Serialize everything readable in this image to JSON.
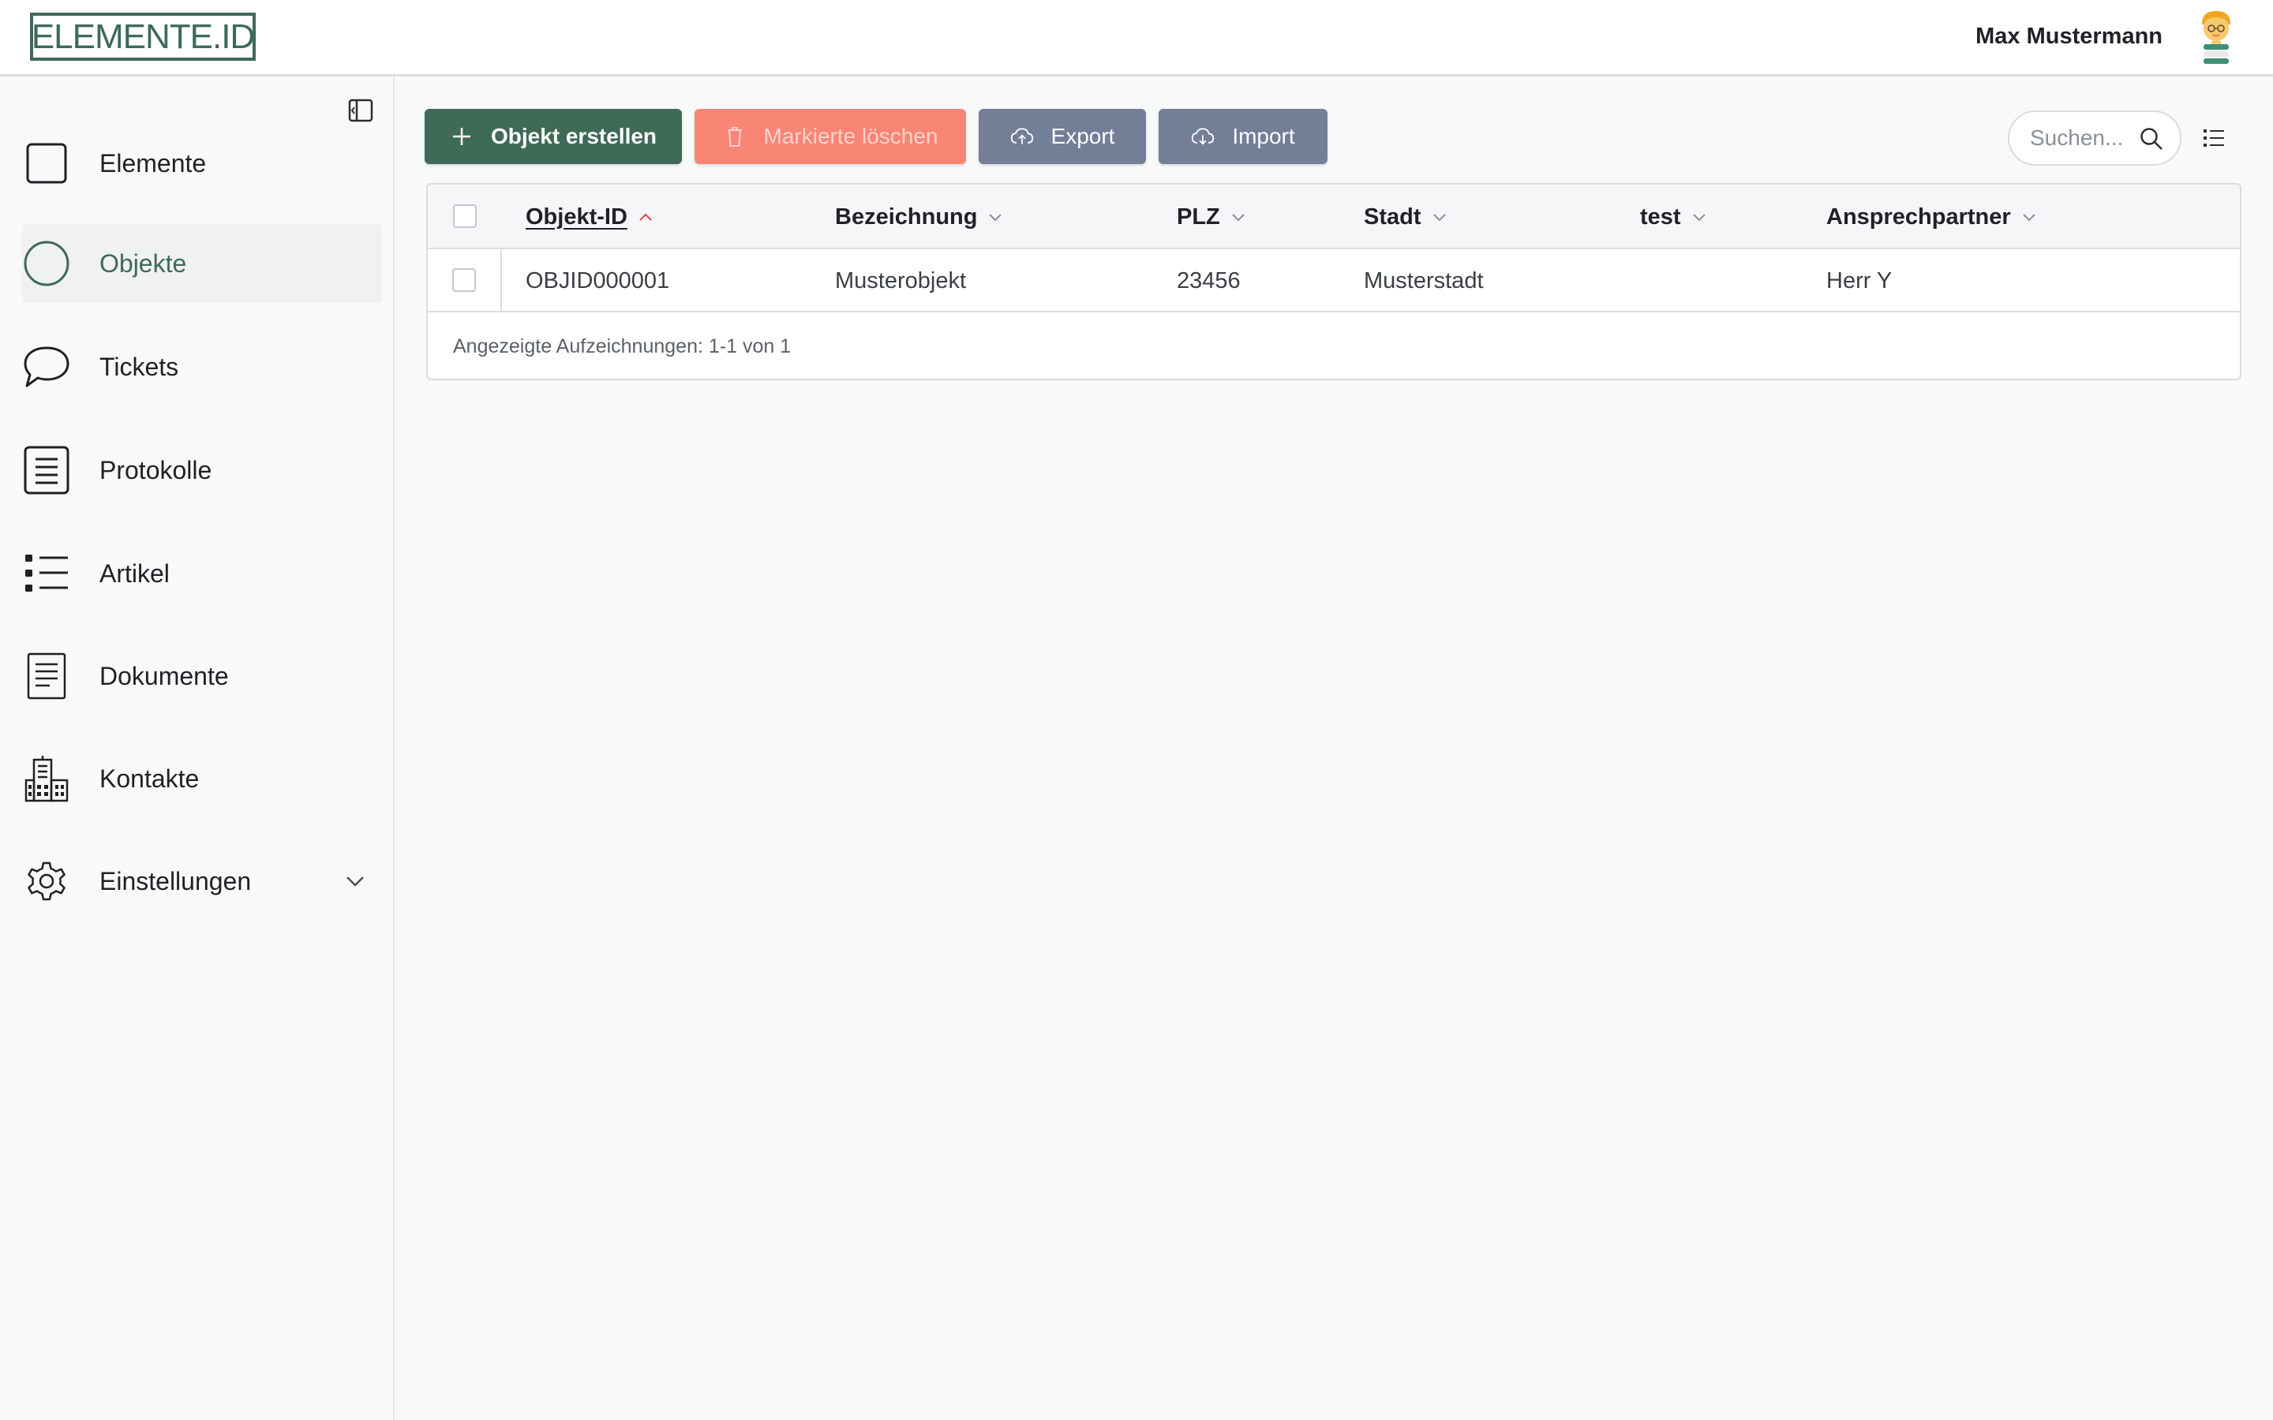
{
  "header": {
    "logo_text": "ELEMENTE.ID",
    "user_name": "Max Mustermann"
  },
  "sidebar": {
    "items": [
      {
        "label": "Elemente",
        "icon": "square-icon"
      },
      {
        "label": "Objekte",
        "icon": "circle-icon",
        "active": true
      },
      {
        "label": "Tickets",
        "icon": "speech-bubble-icon"
      },
      {
        "label": "Protokolle",
        "icon": "protocol-icon"
      },
      {
        "label": "Artikel",
        "icon": "list-icon"
      },
      {
        "label": "Dokumente",
        "icon": "document-icon"
      },
      {
        "label": "Kontakte",
        "icon": "buildings-icon"
      },
      {
        "label": "Einstellungen",
        "icon": "gear-icon",
        "expandable": true
      }
    ]
  },
  "toolbar": {
    "create_label": "Objekt erstellen",
    "delete_label": "Markierte löschen",
    "export_label": "Export",
    "import_label": "Import",
    "search_placeholder": "Suchen..."
  },
  "table": {
    "columns": [
      "Objekt-ID",
      "Bezeichnung",
      "PLZ",
      "Stadt",
      "test",
      "Ansprechpartner"
    ],
    "sorted_column": "Objekt-ID",
    "rows": [
      [
        "OBJID000001",
        "Musterobjekt",
        "23456",
        "Musterstadt",
        "",
        "Herr Y"
      ]
    ],
    "footer": "Angezeigte Aufzeichnungen: 1-1 von 1"
  },
  "colors": {
    "brand": "#3e6a57",
    "danger": "#f98575",
    "secondary": "#737e97",
    "sort_accent": "#d9534f"
  }
}
